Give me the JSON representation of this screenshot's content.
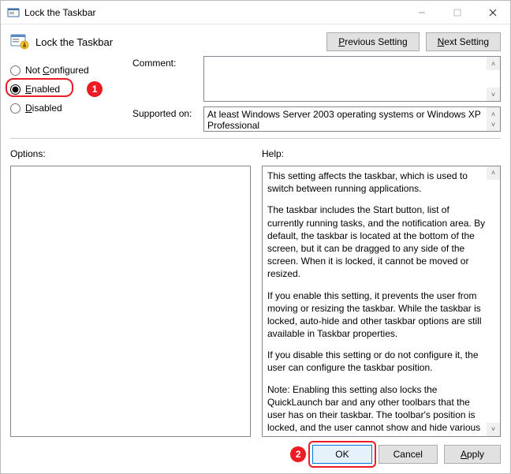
{
  "window": {
    "title": "Lock the Taskbar"
  },
  "header": {
    "policy_title": "Lock the Taskbar",
    "prev_setting": "Previous Setting",
    "next_setting": "Next Setting"
  },
  "radios": {
    "not_configured": "Not Configured",
    "enabled": "Enabled",
    "disabled": "Disabled",
    "selected": "enabled"
  },
  "fields": {
    "comment_label": "Comment:",
    "comment_value": "",
    "supported_label": "Supported on:",
    "supported_value": "At least Windows Server 2003 operating systems or Windows XP Professional"
  },
  "sections": {
    "options_label": "Options:",
    "help_label": "Help:"
  },
  "help": {
    "p1": "This setting affects the taskbar, which is used to switch between running applications.",
    "p2": "The taskbar includes the Start button, list of currently running tasks, and the notification area. By default, the taskbar is located at the bottom of the screen, but it can be dragged to any side of the screen. When it is locked, it cannot be moved or resized.",
    "p3": "If you enable this setting, it prevents the user from moving or resizing the taskbar. While the taskbar is locked, auto-hide and other taskbar options are still available in Taskbar properties.",
    "p4": "If you disable this setting or do not configure it, the user can configure the taskbar position.",
    "p5": "Note: Enabling this setting also locks the QuickLaunch bar and any other toolbars that the user has on their taskbar. The toolbar's position is locked, and the user cannot show and hide various toolbars using the taskbar context menu."
  },
  "footer": {
    "ok": "OK",
    "cancel": "Cancel",
    "apply": "Apply"
  },
  "annotations": {
    "step1": "1",
    "step2": "2"
  }
}
